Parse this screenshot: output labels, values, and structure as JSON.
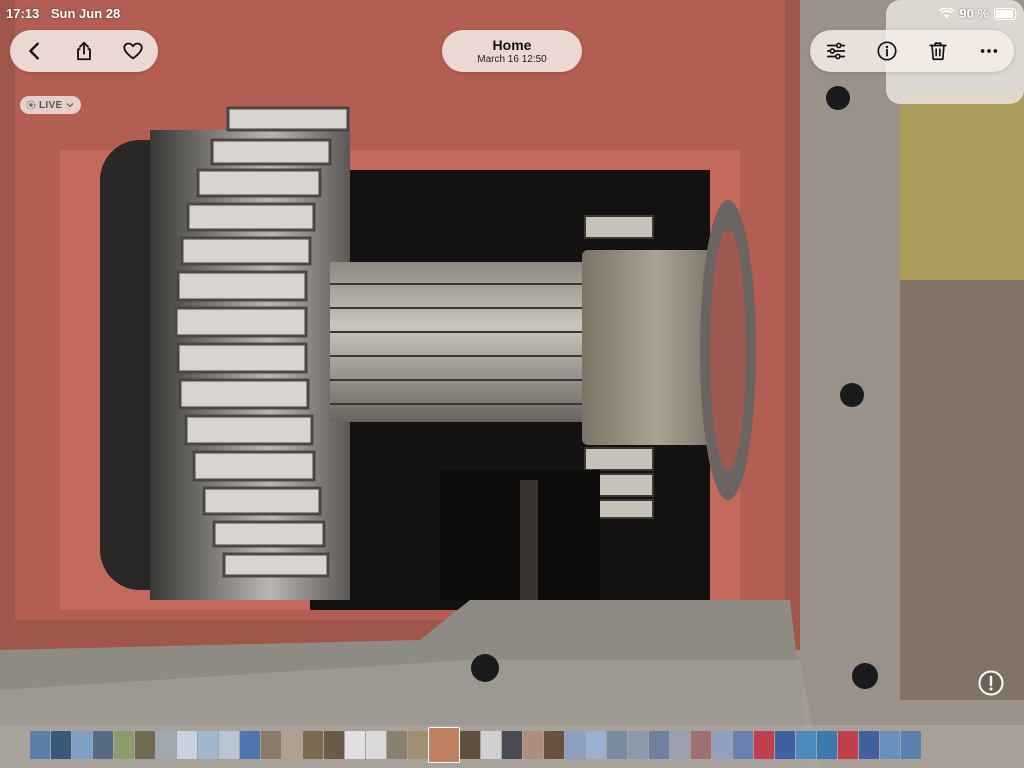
{
  "status_bar": {
    "time": "17:13",
    "date": "Sun Jun 28",
    "battery": "90 %"
  },
  "header": {
    "title": "Home",
    "subtitle": "March 16  12:50"
  },
  "live_badge": "LIVE",
  "icons": {
    "back": "chevron-left-icon",
    "share": "share-icon",
    "favorite": "heart-icon",
    "adjust": "sliders-icon",
    "info": "info-icon",
    "delete": "trash-icon",
    "more": "ellipsis-icon",
    "live": "live-photo-icon",
    "alert": "exclamation-circle-icon"
  },
  "thumbnails": [
    "#5a7fa8",
    "#3a5a7a",
    "#7da0c4",
    "#566b86",
    "#8a9c6b",
    "#6e6a54",
    "#a0a8b2",
    "#c6d2de",
    "#9fb8cf",
    "#b8c6d4",
    "#4e76b0",
    "#8a7a6a",
    "#b0a090",
    "#7a6a50",
    "#6a5a48",
    "#e0e0e0",
    "#dadada",
    "#8a8070",
    "#a09070",
    "#c08060",
    "#605040",
    "#d0d0d0",
    "#4a4a52",
    "#ab8f7a",
    "#6a5040",
    "#8aa0c0",
    "#9ab0d0",
    "#7a8aa0",
    "#8a9aaa",
    "#7080a0",
    "#9aa0b0",
    "#a07070",
    "#90a0c0",
    "#6a80b0",
    "#c04050",
    "#4060a0",
    "#4a8ac0",
    "#3a7ab0",
    "#c04050",
    "#4060a0",
    "#6a90c0",
    "#5a80b0"
  ]
}
